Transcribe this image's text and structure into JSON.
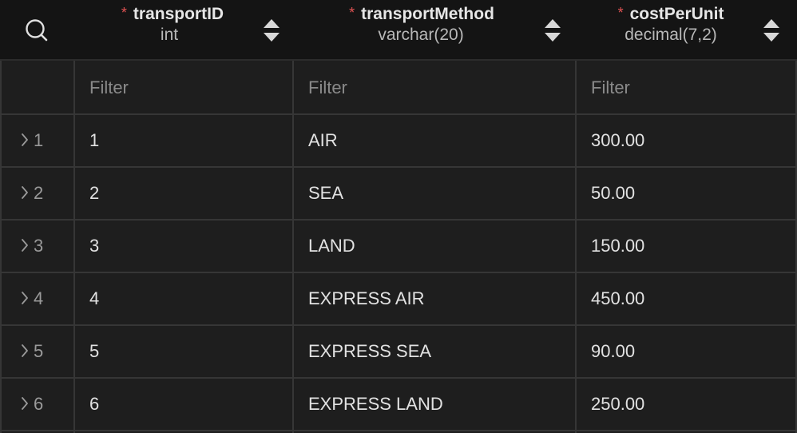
{
  "header": {
    "search_icon": "search-icon",
    "columns": [
      {
        "name": "transportID",
        "type": "int",
        "required_mark": "*"
      },
      {
        "name": "transportMethod",
        "type": "varchar(20)",
        "required_mark": "*"
      },
      {
        "name": "costPerUnit",
        "type": "decimal(7,2)",
        "required_mark": "*"
      }
    ]
  },
  "filters": {
    "transportID": "Filter",
    "transportMethod": "Filter",
    "costPerUnit": "Filter"
  },
  "rows": [
    {
      "index": "1",
      "transportID": "1",
      "transportMethod": "AIR",
      "costPerUnit": "300.00"
    },
    {
      "index": "2",
      "transportID": "2",
      "transportMethod": "SEA",
      "costPerUnit": "50.00"
    },
    {
      "index": "3",
      "transportID": "3",
      "transportMethod": "LAND",
      "costPerUnit": "150.00"
    },
    {
      "index": "4",
      "transportID": "4",
      "transportMethod": "EXPRESS AIR",
      "costPerUnit": "450.00"
    },
    {
      "index": "5",
      "transportID": "5",
      "transportMethod": "EXPRESS SEA",
      "costPerUnit": "90.00"
    },
    {
      "index": "6",
      "transportID": "6",
      "transportMethod": "EXPRESS LAND",
      "costPerUnit": "250.00"
    }
  ],
  "colors": {
    "header_bg": "#141414",
    "cell_bg": "#1e1e1e",
    "grid_line": "#363636",
    "required_star": "#e05252",
    "text": "#e2e2e2",
    "placeholder": "#8a8a8a"
  }
}
